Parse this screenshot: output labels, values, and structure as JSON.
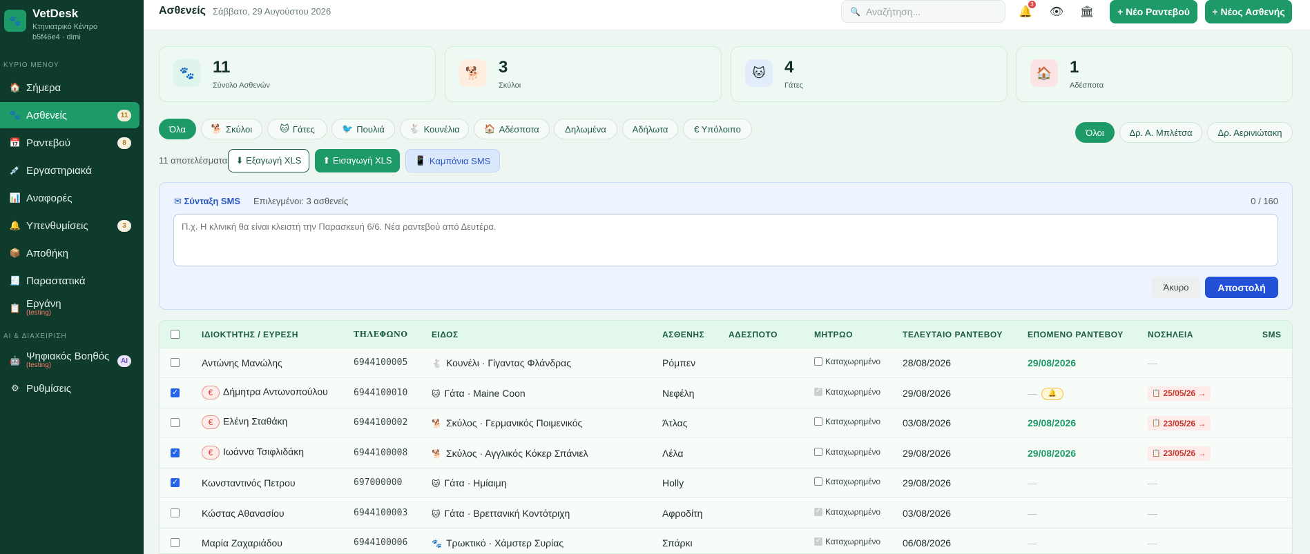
{
  "brand": {
    "name": "VetDesk",
    "subtitle": "Κτηνιατρικό Κέντρο",
    "id": "b5f46e4 · dimi"
  },
  "sidebar": {
    "section_main": "ΚΥΡΙΟ ΜΕΝΟΥ",
    "section_ai": "AI & ΔΙΑΧΕΙΡΙΣΗ",
    "items": [
      {
        "label": "Σήμερα",
        "icon": "home-icon"
      },
      {
        "label": "Ασθενείς",
        "icon": "paw-icon",
        "badge": "11"
      },
      {
        "label": "Ραντεβού",
        "icon": "calendar-icon",
        "badge": "8"
      },
      {
        "label": "Εργαστηριακά",
        "icon": "syringe-icon"
      },
      {
        "label": "Αναφορές",
        "icon": "chart-icon"
      },
      {
        "label": "Υπενθυμίσεις",
        "icon": "bell-icon",
        "badge": "3"
      },
      {
        "label": "Αποθήκη",
        "icon": "box-icon"
      },
      {
        "label": "Παραστατικά",
        "icon": "receipt-icon"
      },
      {
        "label": "Εργάνη",
        "icon": "clipboard-icon",
        "note": "(testing)"
      },
      {
        "label": "Ψηφιακός Βοηθός",
        "icon": "robot-icon",
        "note": "(testing)",
        "badge": "AI"
      },
      {
        "label": "Ρυθμίσεις",
        "icon": "gear-icon"
      }
    ]
  },
  "header": {
    "title": "Ασθενείς",
    "date": "Σάββατο, 29 Αυγούστου 2026",
    "search_placeholder": "Αναζήτηση...",
    "notif_count": "3",
    "new_appointment": "+ Νέο Ραντεβού",
    "new_patient": "+ Νέος Ασθενής"
  },
  "stats": [
    {
      "value": "11",
      "label": "Σύνολο Ασθενών",
      "icon": "paw-icon",
      "bg": "#dff5ec"
    },
    {
      "value": "3",
      "label": "Σκύλοι",
      "icon": "dog-icon",
      "bg": "#fdeee0"
    },
    {
      "value": "4",
      "label": "Γάτες",
      "icon": "cat-icon",
      "bg": "#e3ecfb"
    },
    {
      "value": "1",
      "label": "Αδέσποτα",
      "icon": "shelter-icon",
      "bg": "#fde4e4"
    }
  ],
  "filters": [
    "Όλα",
    "Σκύλοι",
    "Γάτες",
    "Πουλιά",
    "Κουνέλια",
    "Αδέσποτα",
    "Δηλωμένα",
    "Αδήλωτα",
    "€ Υπόλοιπο"
  ],
  "vets": [
    "Όλοι",
    "Δρ. Α. Μπλέτσα",
    "Δρ. Αερινιώτακη"
  ],
  "actions": {
    "results": "11 αποτελέσματα",
    "export": "⬇ Εξαγωγή XLS",
    "import": "⬆ Εισαγωγή XLS",
    "campaign": "Καμπάνια SMS"
  },
  "sms": {
    "title": "✉ Σύνταξη SMS",
    "selected_label": "Επιλεγμένοι:",
    "selected_count": "3 ασθενείς",
    "counter": "0 / 160",
    "placeholder": "Π.χ. Η κλινική θα είναι κλειστή την Παρασκευή 6/6. Νέα ραντεβού από Δευτέρα.",
    "cancel": "Άκυρο",
    "send": "Αποστολή"
  },
  "table": {
    "columns": [
      "ΙΔΙΟΚΤΗΤΗΣ / ΕΥΡΕΣΗ",
      "ΤΗΛΕΦΩΝΟ",
      "ΕΙΔΟΣ",
      "ΑΣΘΕΝΗΣ",
      "ΑΔΕΣΠΟΤΟ",
      "ΜΗΤΡΩΟ",
      "ΤΕΛΕΥΤΑΙΟ ΡΑΝΤΕΒΟΥ",
      "ΕΠΟΜΕΝΟ ΡΑΝΤΕΒΟΥ",
      "ΝΟΣΗΛΕΙΑ",
      "SMS"
    ],
    "registered_label": "Καταχωρημένο",
    "rows": [
      {
        "owner": "Αντώνης Μανώλης",
        "phone": "6944100005",
        "species": "Κουνέλι · Γίγαντας Φλάνδρας",
        "species_icon": "rabbit-icon",
        "patient": "Ρόμπεν",
        "last": "28/08/2026",
        "next": "29/08/2026",
        "hosp": "—",
        "checked": false,
        "euro": false,
        "reg": false
      },
      {
        "owner": "Δήμητρα Αντωνοπούλου",
        "phone": "6944100010",
        "species": "Γάτα · Maine Coon",
        "species_icon": "cat-icon",
        "patient": "Νεφέλη",
        "last": "29/08/2026",
        "next": "—",
        "hosp": "25/05/26 →",
        "checked": true,
        "euro": true,
        "reg": true,
        "bell": true
      },
      {
        "owner": "Ελένη Σταθάκη",
        "phone": "6944100002",
        "species": "Σκύλος · Γερμανικός Ποιμενικός",
        "species_icon": "dog-icon",
        "patient": "Άτλας",
        "last": "03/08/2026",
        "next": "29/08/2026",
        "hosp": "23/05/26 →",
        "checked": false,
        "euro": true,
        "reg": false
      },
      {
        "owner": "Ιωάννα Τσιφλιδάκη",
        "phone": "6944100008",
        "species": "Σκύλος · Αγγλικός Κόκερ Σπάνιελ",
        "species_icon": "dog-icon",
        "patient": "Λέλα",
        "last": "29/08/2026",
        "next": "29/08/2026",
        "hosp": "23/05/26 →",
        "checked": true,
        "euro": true,
        "reg": false
      },
      {
        "owner": "Κωνσταντινός Πετρου",
        "phone": "697000000",
        "species": "Γάτα · Ημίαιμη",
        "species_icon": "cat-icon",
        "patient": "Holly",
        "last": "29/08/2026",
        "next": "—",
        "hosp": "—",
        "checked": true,
        "euro": false,
        "reg": false
      },
      {
        "owner": "Κώστας Αθανασίου",
        "phone": "6944100003",
        "species": "Γάτα · Βρεττανική Κοντότριχη",
        "species_icon": "cat-icon",
        "patient": "Αφροδίτη",
        "last": "03/08/2026",
        "next": "—",
        "hosp": "—",
        "checked": false,
        "euro": false,
        "reg": true
      },
      {
        "owner": "Μαρία Ζαχαριάδου",
        "phone": "6944100006",
        "species": "Τρωκτικό · Χάμστερ Συρίας",
        "species_icon": "rodent-icon",
        "patient": "Σπάρκι",
        "last": "06/08/2026",
        "next": "—",
        "hosp": "—",
        "checked": false,
        "euro": false,
        "reg": true
      }
    ]
  }
}
